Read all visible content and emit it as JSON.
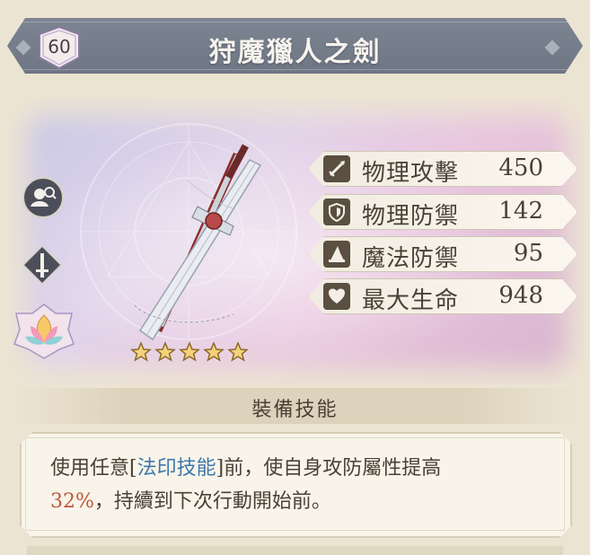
{
  "header": {
    "level": "60",
    "title": "狩魔獵人之劍"
  },
  "rarity": {
    "stars": 5
  },
  "side_icons": [
    "search-character-icon",
    "sword-slot-icon",
    "lotus-emblem-icon"
  ],
  "stats": [
    {
      "icon": "sword-icon",
      "label": "物理攻擊",
      "value": "450"
    },
    {
      "icon": "shield-icon",
      "label": "物理防禦",
      "value": "142"
    },
    {
      "icon": "wizard-hat-icon",
      "label": "魔法防禦",
      "value": "95"
    },
    {
      "icon": "heart-icon",
      "label": "最大生命",
      "value": "948"
    }
  ],
  "skill": {
    "title": "裝備技能",
    "text_before": "使用任意[",
    "keyword": "法印技能",
    "text_middle": "]前，使自身攻防屬性提高",
    "percent": "32%",
    "text_after": "，持續到下次行動開始前。"
  },
  "colors": {
    "banner": "#737b89",
    "keyword_blue": "#3f78a9",
    "percent_red": "#c0583c",
    "text_dark": "#4a4036"
  }
}
